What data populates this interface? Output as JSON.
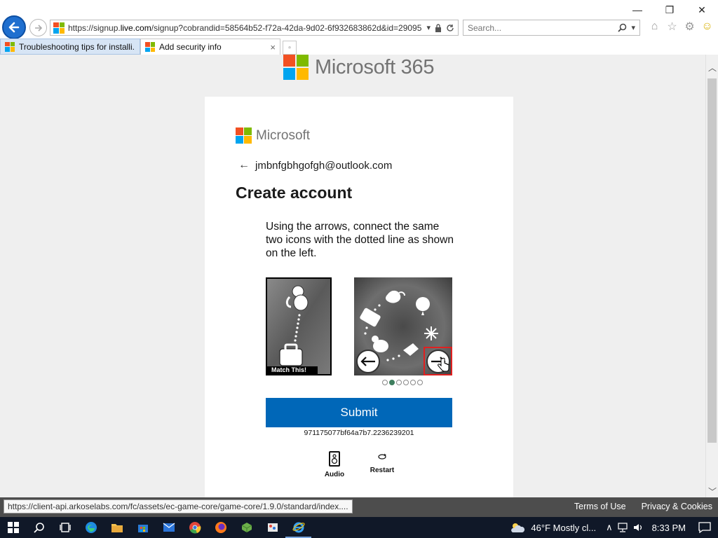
{
  "browser": {
    "url_prefix": "https://signup.",
    "url_domain": "live.com",
    "url_rest": "/signup?cobrandid=58564b52-f72a-42da-9d02-6f932683862d&id=29095",
    "search_placeholder": "Search...",
    "window_controls": {
      "minimize": "—",
      "restore": "❐",
      "close": "✕"
    },
    "tabs": [
      {
        "title": "Troubleshooting tips for installi...",
        "active": false
      },
      {
        "title": "Add security info",
        "active": true,
        "close": "×"
      }
    ],
    "status_url": "https://client-api.arkoselabs.com/fc/assets/ec-game-core/game-core/1.9.0/standard/index...."
  },
  "page": {
    "brand": "Microsoft 365",
    "card": {
      "logo_text": "Microsoft",
      "back_arrow": "←",
      "email": "jmbnfgbhgofgh@outlook.com",
      "title": "Create account",
      "instruction": "Using the arrows, connect the same two icons with the dotted line as shown on the left.",
      "match_label": "Match This!",
      "dots_total": 6,
      "dots_active_index": 1,
      "submit_label": "Submit",
      "session_id": "971175077bf64a7b7.2236239201",
      "audio_label": "Audio",
      "restart_label": "Restart"
    },
    "footer": {
      "terms": "Terms of Use",
      "privacy": "Privacy & Cookies"
    }
  },
  "taskbar": {
    "icons": [
      "windows-start-icon",
      "search-icon",
      "task-view-icon",
      "edge-icon",
      "file-explorer-icon",
      "store-icon",
      "mail-icon",
      "chrome-icon",
      "firefox-icon",
      "minecraft-icon",
      "paint-icon",
      "internet-explorer-icon"
    ],
    "temperature": "46°F",
    "weather_text": "Mostly cl...",
    "time": "8:33 PM"
  },
  "colors": {
    "ms_red": "#f25022",
    "ms_green": "#7fba00",
    "ms_blue": "#00a4ef",
    "ms_yellow": "#ffb900",
    "submit_blue": "#0067b8",
    "taskbar": "#101828"
  }
}
